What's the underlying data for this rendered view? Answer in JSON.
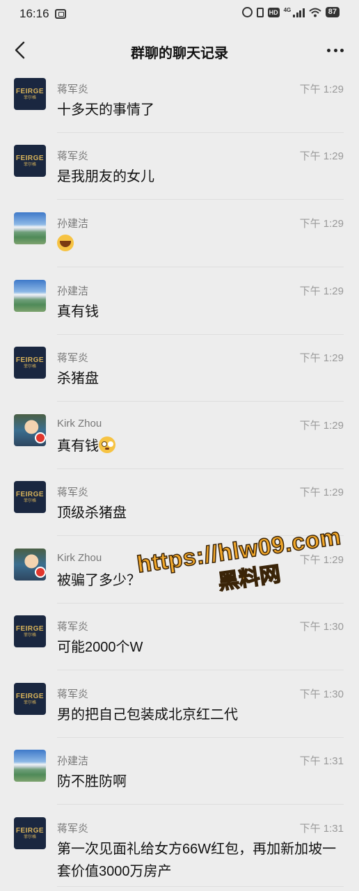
{
  "status_bar": {
    "time": "16:16",
    "network": "4G",
    "hd": "HD",
    "battery": "87"
  },
  "header": {
    "title": "群聊的聊天记录",
    "back_icon": "chevron-left-icon",
    "more_icon": "more-dots-icon"
  },
  "messages": [
    {
      "sender": "蒋军炎",
      "avatar": "feirge",
      "time": "下午 1:29",
      "text": "十多天的事情了"
    },
    {
      "sender": "蒋军炎",
      "avatar": "feirge",
      "time": "下午 1:29",
      "text": "是我朋友的女儿"
    },
    {
      "sender": "孙建洁",
      "avatar": "landscape",
      "time": "下午 1:29",
      "text": "",
      "emoji": "laugh-cry-emoji"
    },
    {
      "sender": "孙建洁",
      "avatar": "landscape",
      "time": "下午 1:29",
      "text": "真有钱"
    },
    {
      "sender": "蒋军炎",
      "avatar": "feirge",
      "time": "下午 1:29",
      "text": "杀猪盘"
    },
    {
      "sender": "Kirk Zhou",
      "avatar": "anime",
      "time": "下午 1:29",
      "text": "真有钱",
      "emoji": "flushed-emoji"
    },
    {
      "sender": "蒋军炎",
      "avatar": "feirge",
      "time": "下午 1:29",
      "text": "顶级杀猪盘"
    },
    {
      "sender": "Kirk Zhou",
      "avatar": "anime",
      "time": "下午 1:29",
      "text": "被骗了多少？"
    },
    {
      "sender": "蒋军炎",
      "avatar": "feirge",
      "time": "下午 1:30",
      "text": "可能2000个W"
    },
    {
      "sender": "蒋军炎",
      "avatar": "feirge",
      "time": "下午 1:30",
      "text": "男的把自己包装成北京红二代"
    },
    {
      "sender": "孙建洁",
      "avatar": "landscape",
      "time": "下午 1:31",
      "text": "防不胜防啊"
    },
    {
      "sender": "蒋军炎",
      "avatar": "feirge",
      "time": "下午 1:31",
      "text": "第一次见面礼给女方66W红包，再加新加坡一套价值3000万房产"
    }
  ],
  "avatar_logo": {
    "main": "FEIRGE",
    "sub": "菲尔格"
  },
  "watermark": {
    "line1": "https://hlw09.com",
    "line2": "黑料网"
  },
  "colors": {
    "background": "#ededed",
    "watermark": "#f0a629",
    "badge": "#e1362d"
  }
}
